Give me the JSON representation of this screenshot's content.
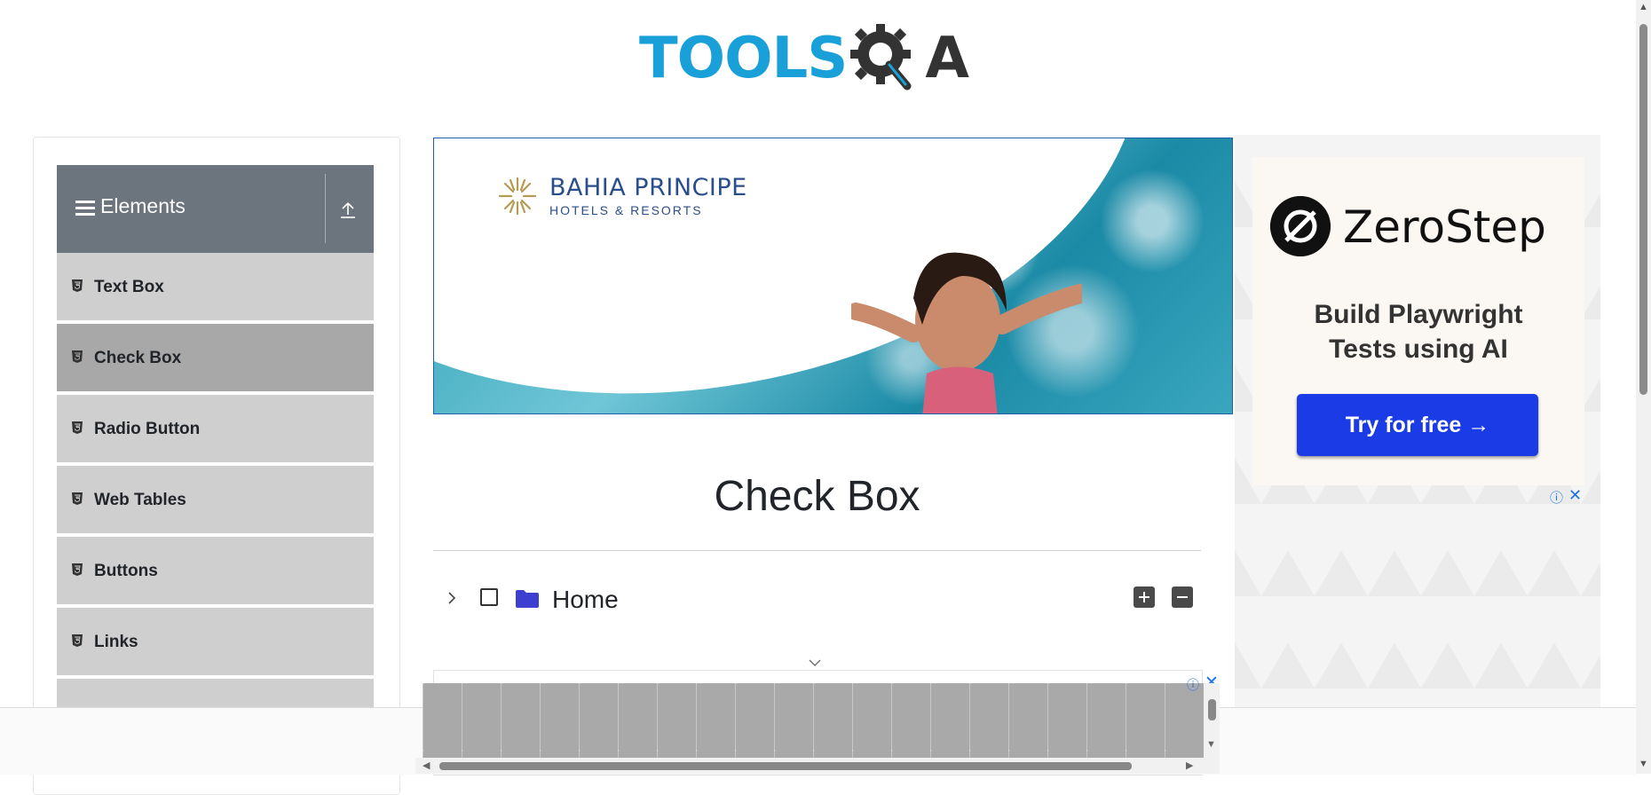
{
  "header": {
    "logo_text_primary": "TOOLS",
    "logo_text_secondary": "A"
  },
  "sidebar": {
    "group_title": "Elements",
    "items": [
      {
        "label": "Text Box",
        "active": false
      },
      {
        "label": "Check Box",
        "active": true
      },
      {
        "label": "Radio Button",
        "active": false
      },
      {
        "label": "Web Tables",
        "active": false
      },
      {
        "label": "Buttons",
        "active": false
      },
      {
        "label": "Links",
        "active": false
      }
    ]
  },
  "banner_ad": {
    "brand_name": "BAHIA PRINCIPE",
    "brand_subtitle": "HOTELS & RESORTS"
  },
  "right_ad": {
    "brand": "ZeroStep",
    "tagline_line1": "Build Playwright",
    "tagline_line2": "Tests using AI",
    "cta_label": "Try for free →"
  },
  "main": {
    "page_title": "Check Box",
    "tree": {
      "root_label": "Home",
      "checked": false,
      "expanded": false
    }
  },
  "colors": {
    "logo_blue": "#1aa0d8",
    "sidebar_header": "#6c757d",
    "sidebar_item": "#cfcfcf",
    "sidebar_item_active": "#a8a8a8",
    "folder": "#3c3fd0",
    "cta_blue": "#1a3be6"
  }
}
